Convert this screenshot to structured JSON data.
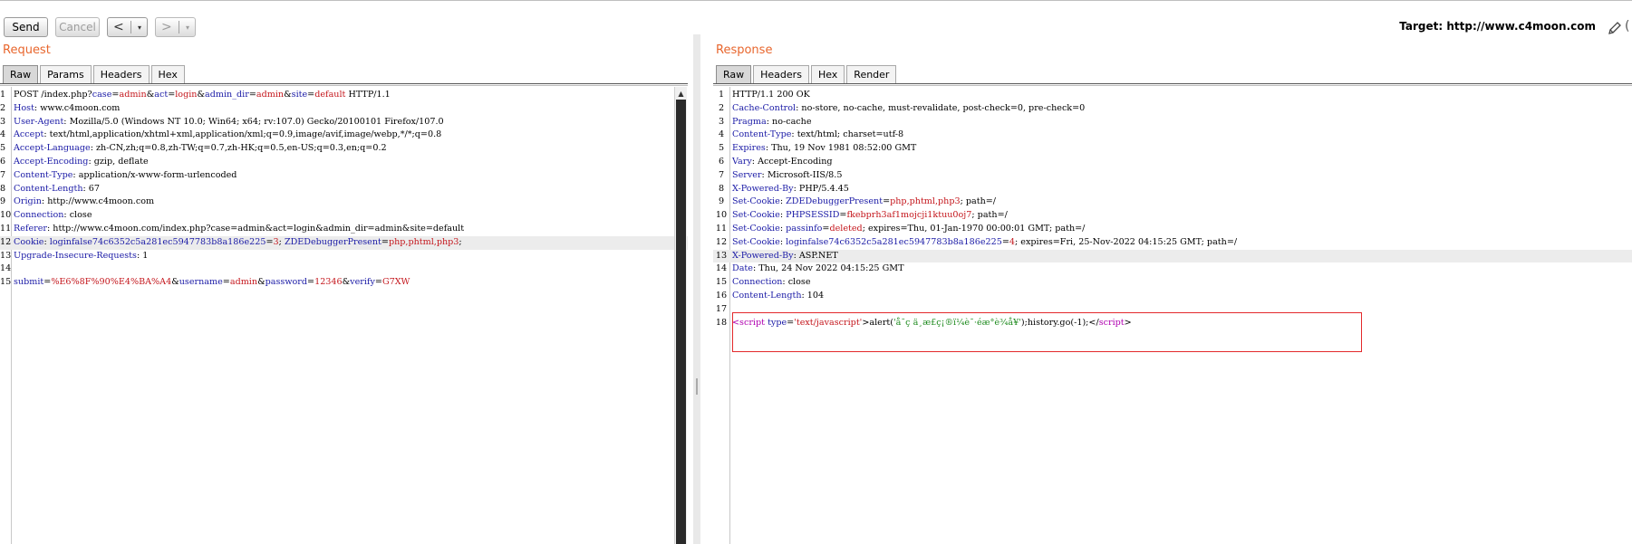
{
  "toolbar": {
    "send_label": "Send",
    "cancel_label": "Cancel",
    "back_arrow": "<",
    "forward_arrow": ">",
    "dropdown_caret": "▾",
    "target_label": "Target: http://www.c4moon.com",
    "help_glyph": "("
  },
  "request": {
    "title": "Request",
    "tabs": [
      "Raw",
      "Params",
      "Headers",
      "Hex"
    ],
    "active_tab": "Raw",
    "lines": [
      {
        "num": "1",
        "segs": [
          {
            "t": "POST /index.php?",
            "c": ""
          },
          {
            "t": "case",
            "c": "p"
          },
          {
            "t": "=",
            "c": ""
          },
          {
            "t": "admin",
            "c": "v"
          },
          {
            "t": "&",
            "c": ""
          },
          {
            "t": "act",
            "c": "p"
          },
          {
            "t": "=",
            "c": ""
          },
          {
            "t": "login",
            "c": "v"
          },
          {
            "t": "&",
            "c": ""
          },
          {
            "t": "admin_dir",
            "c": "p"
          },
          {
            "t": "=",
            "c": ""
          },
          {
            "t": "admin",
            "c": "v"
          },
          {
            "t": "&",
            "c": ""
          },
          {
            "t": "site",
            "c": "p"
          },
          {
            "t": "=",
            "c": ""
          },
          {
            "t": "default",
            "c": "v"
          },
          {
            "t": " HTTP/1.1",
            "c": ""
          }
        ]
      },
      {
        "num": "2",
        "segs": [
          {
            "t": "Host",
            "c": "k"
          },
          {
            "t": ": www.c4moon.com",
            "c": ""
          }
        ]
      },
      {
        "num": "3",
        "segs": [
          {
            "t": "User-Agent",
            "c": "k"
          },
          {
            "t": ": Mozilla/5.0 (Windows NT 10.0; Win64; x64; rv:107.0) Gecko/20100101 Firefox/107.0",
            "c": ""
          }
        ]
      },
      {
        "num": "4",
        "segs": [
          {
            "t": "Accept",
            "c": "k"
          },
          {
            "t": ": text/html,application/xhtml+xml,application/xml;q=0.9,image/avif,image/webp,*/*;q=0.8",
            "c": ""
          }
        ]
      },
      {
        "num": "5",
        "segs": [
          {
            "t": "Accept-Language",
            "c": "k"
          },
          {
            "t": ": zh-CN,zh;q=0.8,zh-TW;q=0.7,zh-HK;q=0.5,en-US;q=0.3,en;q=0.2",
            "c": ""
          }
        ]
      },
      {
        "num": "6",
        "segs": [
          {
            "t": "Accept-Encoding",
            "c": "k"
          },
          {
            "t": ": gzip, deflate",
            "c": ""
          }
        ]
      },
      {
        "num": "7",
        "segs": [
          {
            "t": "Content-Type",
            "c": "k"
          },
          {
            "t": ": application/x-www-form-urlencoded",
            "c": ""
          }
        ]
      },
      {
        "num": "8",
        "segs": [
          {
            "t": "Content-Length",
            "c": "k"
          },
          {
            "t": ": 67",
            "c": ""
          }
        ]
      },
      {
        "num": "9",
        "segs": [
          {
            "t": "Origin",
            "c": "k"
          },
          {
            "t": ": http://www.c4moon.com",
            "c": ""
          }
        ]
      },
      {
        "num": "10",
        "segs": [
          {
            "t": "Connection",
            "c": "k"
          },
          {
            "t": ": close",
            "c": ""
          }
        ]
      },
      {
        "num": "11",
        "segs": [
          {
            "t": "Referer",
            "c": "k"
          },
          {
            "t": ": http://www.c4moon.com/index.php?case=admin&act=login&admin_dir=admin&site=default",
            "c": ""
          }
        ]
      },
      {
        "num": "12",
        "hl": true,
        "segs": [
          {
            "t": "Cookie",
            "c": "k"
          },
          {
            "t": ": ",
            "c": ""
          },
          {
            "t": "loginfalse74c6352c5a281ec5947783b8a186e225",
            "c": "p"
          },
          {
            "t": "=",
            "c": ""
          },
          {
            "t": "3",
            "c": "v"
          },
          {
            "t": "; ",
            "c": ""
          },
          {
            "t": "ZDEDebuggerPresent",
            "c": "p"
          },
          {
            "t": "=",
            "c": ""
          },
          {
            "t": "php,phtml,php3",
            "c": "v"
          },
          {
            "t": ";",
            "c": ""
          }
        ]
      },
      {
        "num": "13",
        "segs": [
          {
            "t": "Upgrade-Insecure-Requests",
            "c": "k"
          },
          {
            "t": ": 1",
            "c": ""
          }
        ]
      },
      {
        "num": "14",
        "segs": []
      },
      {
        "num": "15",
        "segs": [
          {
            "t": "submit",
            "c": "p"
          },
          {
            "t": "=",
            "c": ""
          },
          {
            "t": "%E6%8F%90%E4%BA%A4",
            "c": "v"
          },
          {
            "t": "&",
            "c": ""
          },
          {
            "t": "username",
            "c": "p"
          },
          {
            "t": "=",
            "c": ""
          },
          {
            "t": "admin",
            "c": "v"
          },
          {
            "t": "&",
            "c": ""
          },
          {
            "t": "password",
            "c": "p"
          },
          {
            "t": "=",
            "c": ""
          },
          {
            "t": "12346",
            "c": "v"
          },
          {
            "t": "&",
            "c": ""
          },
          {
            "t": "verify",
            "c": "p"
          },
          {
            "t": "=",
            "c": ""
          },
          {
            "t": "G7XW",
            "c": "v"
          }
        ]
      }
    ]
  },
  "response": {
    "title": "Response",
    "tabs": [
      "Raw",
      "Headers",
      "Hex",
      "Render"
    ],
    "active_tab": "Raw",
    "lines": [
      {
        "num": "1",
        "segs": [
          {
            "t": "HTTP/1.1 200 OK",
            "c": ""
          }
        ]
      },
      {
        "num": "2",
        "segs": [
          {
            "t": "Cache-Control",
            "c": "k"
          },
          {
            "t": ": no-store, no-cache, must-revalidate, post-check=0, pre-check=0",
            "c": ""
          }
        ]
      },
      {
        "num": "3",
        "segs": [
          {
            "t": "Pragma",
            "c": "k"
          },
          {
            "t": ": no-cache",
            "c": ""
          }
        ]
      },
      {
        "num": "4",
        "segs": [
          {
            "t": "Content-Type",
            "c": "k"
          },
          {
            "t": ": text/html; charset=utf-8",
            "c": ""
          }
        ]
      },
      {
        "num": "5",
        "segs": [
          {
            "t": "Expires",
            "c": "k"
          },
          {
            "t": ": Thu, 19 Nov 1981 08:52:00 GMT",
            "c": ""
          }
        ]
      },
      {
        "num": "6",
        "segs": [
          {
            "t": "Vary",
            "c": "k"
          },
          {
            "t": ": Accept-Encoding",
            "c": ""
          }
        ]
      },
      {
        "num": "7",
        "segs": [
          {
            "t": "Server",
            "c": "k"
          },
          {
            "t": ": Microsoft-IIS/8.5",
            "c": ""
          }
        ]
      },
      {
        "num": "8",
        "segs": [
          {
            "t": "X-Powered-By",
            "c": "k"
          },
          {
            "t": ": PHP/5.4.45",
            "c": ""
          }
        ]
      },
      {
        "num": "9",
        "segs": [
          {
            "t": "Set-Cookie",
            "c": "k"
          },
          {
            "t": ": ",
            "c": ""
          },
          {
            "t": "ZDEDebuggerPresent",
            "c": "p"
          },
          {
            "t": "=",
            "c": ""
          },
          {
            "t": "php,phtml,php3",
            "c": "v"
          },
          {
            "t": "; path=/",
            "c": ""
          }
        ]
      },
      {
        "num": "10",
        "segs": [
          {
            "t": "Set-Cookie",
            "c": "k"
          },
          {
            "t": ": ",
            "c": ""
          },
          {
            "t": "PHPSESSID",
            "c": "p"
          },
          {
            "t": "=",
            "c": ""
          },
          {
            "t": "fkebprh3af1mojcji1ktuu0oj7",
            "c": "v"
          },
          {
            "t": "; path=/",
            "c": ""
          }
        ]
      },
      {
        "num": "11",
        "segs": [
          {
            "t": "Set-Cookie",
            "c": "k"
          },
          {
            "t": ": ",
            "c": ""
          },
          {
            "t": "passinfo",
            "c": "p"
          },
          {
            "t": "=",
            "c": ""
          },
          {
            "t": "deleted",
            "c": "v"
          },
          {
            "t": "; expires=Thu, 01-Jan-1970 00:00:01 GMT; path=/",
            "c": ""
          }
        ]
      },
      {
        "num": "12",
        "segs": [
          {
            "t": "Set-Cookie",
            "c": "k"
          },
          {
            "t": ": ",
            "c": ""
          },
          {
            "t": "loginfalse74c6352c5a281ec5947783b8a186e225",
            "c": "p"
          },
          {
            "t": "=",
            "c": ""
          },
          {
            "t": "4",
            "c": "v"
          },
          {
            "t": "; expires=Fri, 25-Nov-2022 04:15:25 GMT; path=/",
            "c": ""
          }
        ]
      },
      {
        "num": "13",
        "hl": true,
        "segs": [
          {
            "t": "X-Powered-By",
            "c": "k"
          },
          {
            "t": ": ASP.NET",
            "c": ""
          }
        ]
      },
      {
        "num": "14",
        "segs": [
          {
            "t": "Date",
            "c": "k"
          },
          {
            "t": ": Thu, 24 Nov 2022 04:15:25 GMT",
            "c": ""
          }
        ]
      },
      {
        "num": "15",
        "segs": [
          {
            "t": "Connection",
            "c": "k"
          },
          {
            "t": ": close",
            "c": ""
          }
        ]
      },
      {
        "num": "16",
        "segs": [
          {
            "t": "Content-Length",
            "c": "k"
          },
          {
            "t": ": 104",
            "c": ""
          }
        ]
      },
      {
        "num": "17",
        "segs": []
      },
      {
        "num": "18",
        "segs": [
          {
            "t": "<script",
            "c": "tagc"
          },
          {
            "t": " ",
            "c": ""
          },
          {
            "t": "type",
            "c": "attr"
          },
          {
            "t": "=",
            "c": ""
          },
          {
            "t": "'text/javascript'",
            "c": "v"
          },
          {
            "t": ">alert(",
            "c": ""
          },
          {
            "t": "'å¯ç ä¸æ­£ç¡®ï¼è¯·éæ°è¾å¥'",
            "c": "str"
          },
          {
            "t": ");history.go(-1);</",
            "c": ""
          },
          {
            "t": "script",
            "c": "tagc"
          },
          {
            "t": ">",
            "c": ""
          }
        ]
      }
    ]
  },
  "colors": {
    "title_orange": "#e8662d",
    "header_name": "#1a1aa6",
    "param_value": "#c4161c",
    "highlight_box": "#e3292b"
  }
}
